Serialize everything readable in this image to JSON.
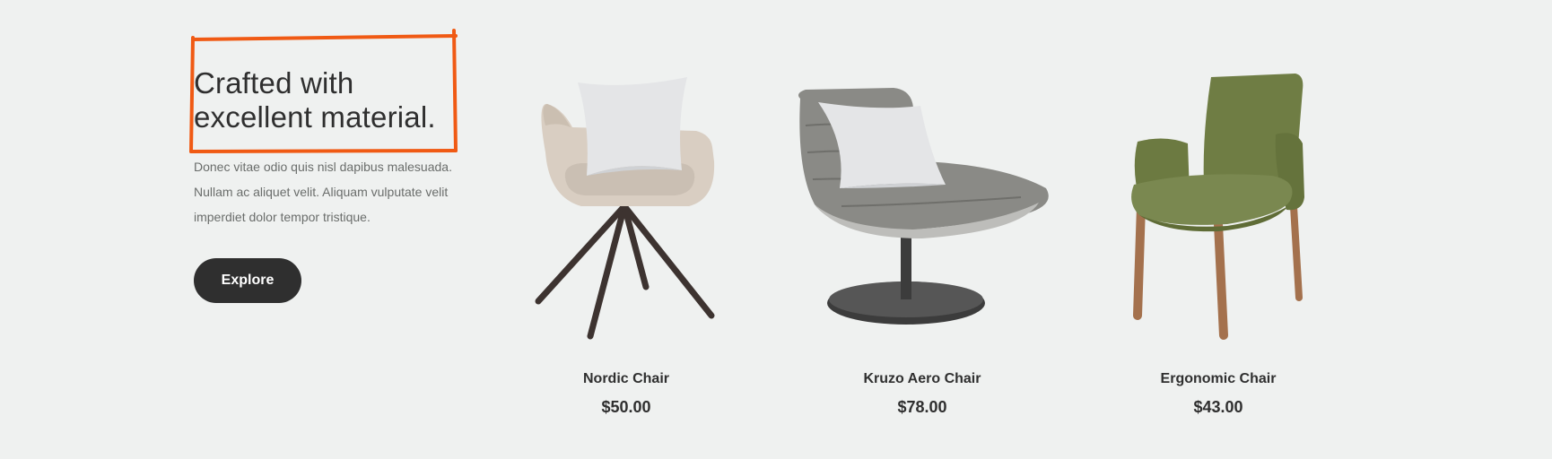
{
  "intro": {
    "headline_line1": "Crafted with",
    "headline_line2": "excellent material.",
    "desc_line1": "Donec vitae odio quis nisl dapibus malesuada.",
    "desc_line2": "Nullam ac aliquet velit. Aliquam vulputate velit",
    "desc_line3": "imperdiet dolor tempor tristique.",
    "explore_label": "Explore"
  },
  "products": [
    {
      "name": "Nordic Chair",
      "price": "$50.00",
      "icon": "swivel-armchair-with-pillow"
    },
    {
      "name": "Kruzo Aero Chair",
      "price": "$78.00",
      "icon": "lounge-chair-with-pillow"
    },
    {
      "name": "Ergonomic Chair",
      "price": "$43.00",
      "icon": "green-armchair"
    }
  ],
  "colors": {
    "background": "#eff1f0",
    "text": "#2f2f2f",
    "button": "#2f2f2f",
    "annotation": "#f05a14"
  }
}
